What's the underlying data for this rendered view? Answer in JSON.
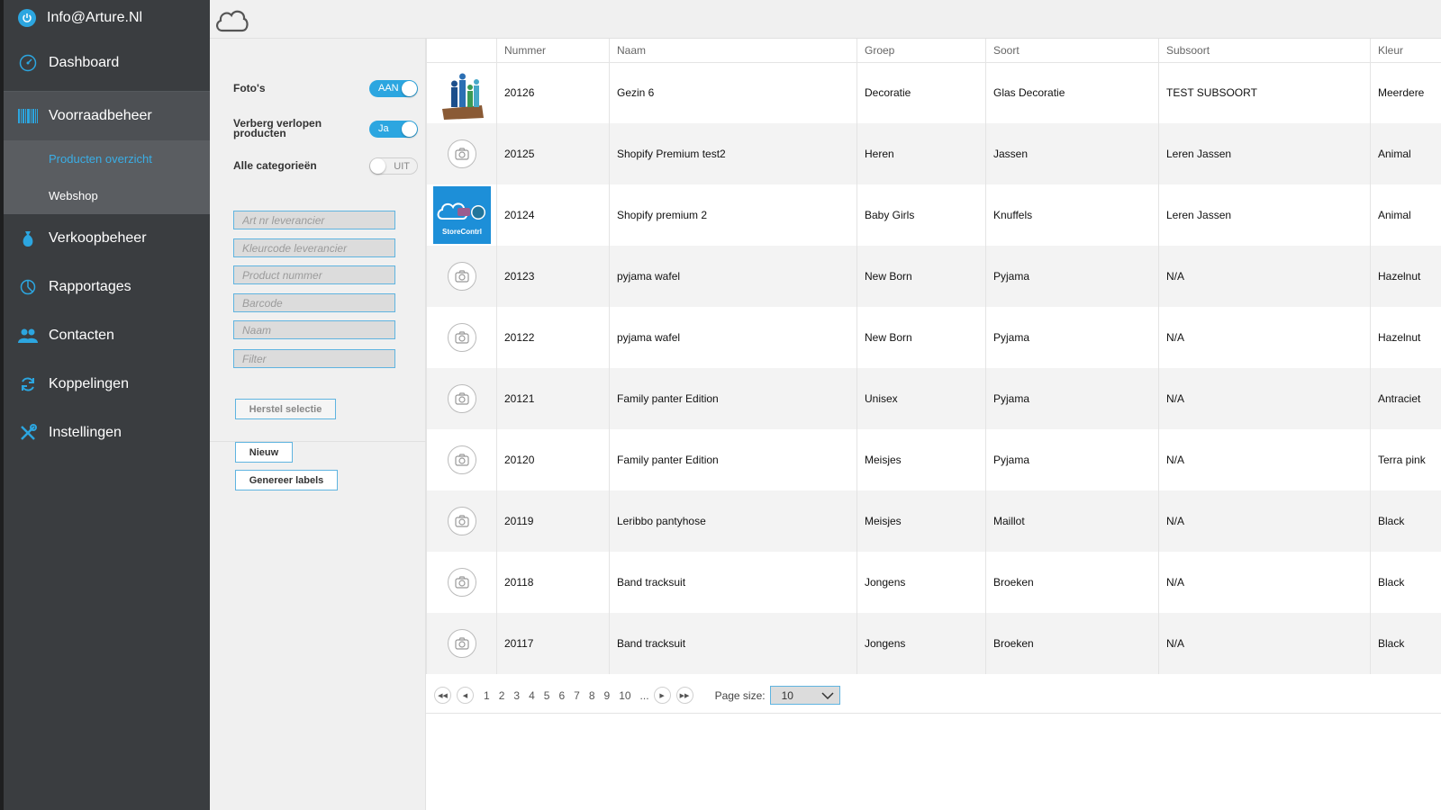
{
  "sidebar": {
    "user": "Info@Arture.Nl",
    "items": [
      {
        "label": "Dashboard",
        "icon": "dashboard-icon"
      },
      {
        "label": "Voorraadbeheer",
        "icon": "barcode-icon"
      },
      {
        "label": "Verkoopbeheer",
        "icon": "money-bag-icon"
      },
      {
        "label": "Rapportages",
        "icon": "chart-icon"
      },
      {
        "label": "Contacten",
        "icon": "people-icon"
      },
      {
        "label": "Koppelingen",
        "icon": "sync-icon"
      },
      {
        "label": "Instellingen",
        "icon": "tools-icon"
      }
    ],
    "submenu": [
      "Producten overzicht",
      "Webshop"
    ]
  },
  "filters": {
    "toggles": [
      {
        "label": "Foto's",
        "state": "AAN",
        "on": true
      },
      {
        "label": "Verberg verlopen producten",
        "state": "Ja",
        "on": true
      },
      {
        "label": "Alle categorieën",
        "state": "UIT",
        "on": false
      }
    ],
    "inputs": [
      {
        "placeholder": "Art nr leverancier"
      },
      {
        "placeholder": "Kleurcode leverancier"
      },
      {
        "placeholder": "Product nummer"
      },
      {
        "placeholder": "Barcode"
      },
      {
        "placeholder": "Naam"
      },
      {
        "placeholder": "Filter"
      }
    ],
    "reset_label": "Herstel selectie",
    "new_label": "Nieuw",
    "labels_label": "Genereer labels"
  },
  "table": {
    "columns": [
      "",
      "Nummer",
      "Naam",
      "Groep",
      "Soort",
      "Subsoort",
      "Kleur"
    ],
    "rows": [
      {
        "image": "family-figures",
        "nummer": "20126",
        "naam": "Gezin 6",
        "groep": "Decoratie",
        "soort": "Glas Decoratie",
        "subsoort": "TEST SUBSOORT",
        "kleur": "Meerdere"
      },
      {
        "image": "camera",
        "nummer": "20125",
        "naam": "Shopify Premium test2",
        "groep": "Heren",
        "soort": "Jassen",
        "subsoort": "Leren Jassen",
        "kleur": "Animal"
      },
      {
        "image": "storecontrl-logo",
        "nummer": "20124",
        "naam": "Shopify premium 2",
        "groep": "Baby Girls",
        "soort": "Knuffels",
        "subsoort": "Leren Jassen",
        "kleur": "Animal"
      },
      {
        "image": "camera",
        "nummer": "20123",
        "naam": "pyjama wafel",
        "groep": "New Born",
        "soort": "Pyjama",
        "subsoort": "N/A",
        "kleur": "Hazelnut"
      },
      {
        "image": "camera",
        "nummer": "20122",
        "naam": "pyjama wafel",
        "groep": "New Born",
        "soort": "Pyjama",
        "subsoort": "N/A",
        "kleur": "Hazelnut"
      },
      {
        "image": "camera",
        "nummer": "20121",
        "naam": "Family panter Edition",
        "groep": "Unisex",
        "soort": "Pyjama",
        "subsoort": "N/A",
        "kleur": "Antraciet"
      },
      {
        "image": "camera",
        "nummer": "20120",
        "naam": "Family panter Edition",
        "groep": "Meisjes",
        "soort": "Pyjama",
        "subsoort": "N/A",
        "kleur": "Terra pink"
      },
      {
        "image": "camera",
        "nummer": "20119",
        "naam": "Leribbo pantyhose",
        "groep": "Meisjes",
        "soort": "Maillot",
        "subsoort": "N/A",
        "kleur": "Black"
      },
      {
        "image": "camera",
        "nummer": "20118",
        "naam": "Band tracksuit",
        "groep": "Jongens",
        "soort": "Broeken",
        "subsoort": "N/A",
        "kleur": "Black"
      },
      {
        "image": "camera",
        "nummer": "20117",
        "naam": "Band tracksuit",
        "groep": "Jongens",
        "soort": "Broeken",
        "subsoort": "N/A",
        "kleur": "Black"
      }
    ]
  },
  "pager": {
    "pages": [
      "1",
      "2",
      "3",
      "4",
      "5",
      "6",
      "7",
      "8",
      "9",
      "10",
      "..."
    ],
    "page_size_label": "Page size:",
    "page_size": "10"
  },
  "colors": {
    "accent": "#2ca6e0",
    "sidebar": "#3a3d40",
    "panel": "#f0f0f0"
  }
}
